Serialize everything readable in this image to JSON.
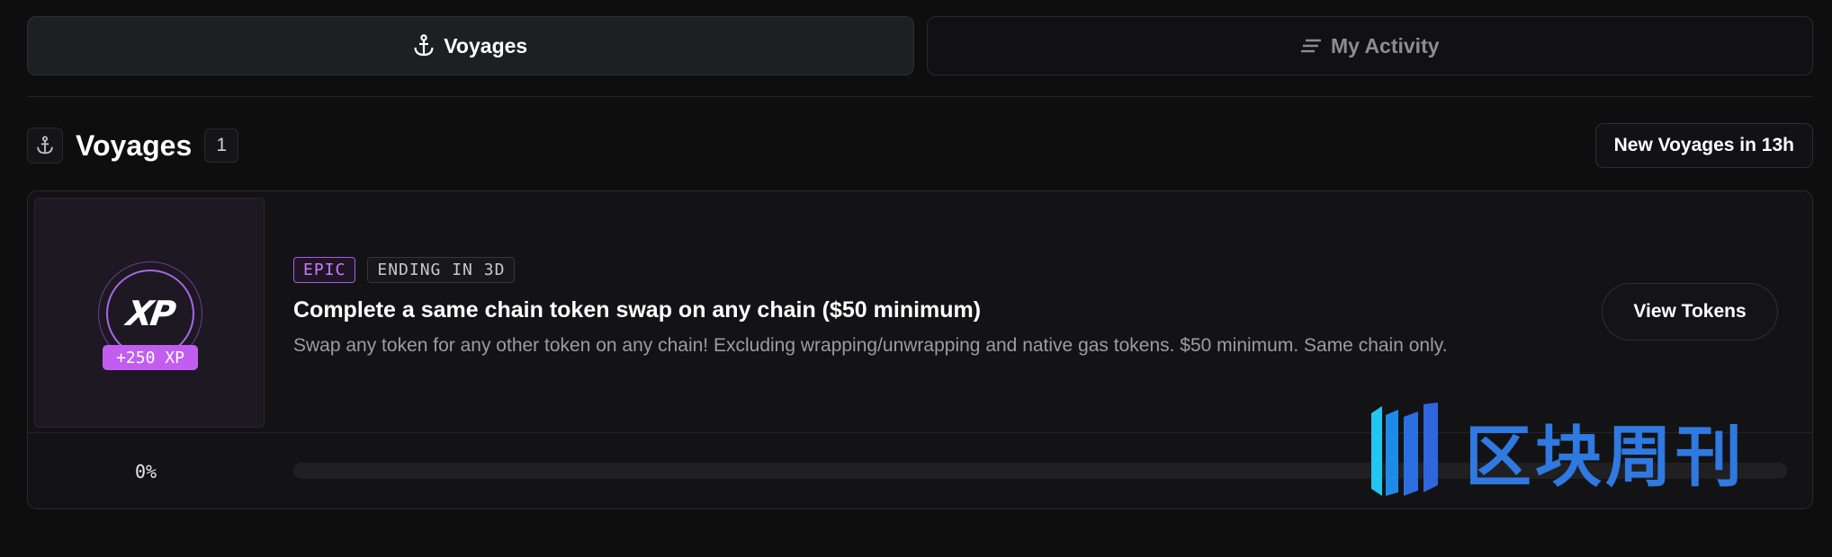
{
  "tabs": [
    {
      "label": "Voyages",
      "icon": "anchor-icon",
      "active": true
    },
    {
      "label": "My Activity",
      "icon": "list-lines-icon",
      "active": false
    }
  ],
  "section": {
    "title": "Voyages",
    "count": "1",
    "icon": "anchor-icon",
    "new_voyages_label": "New Voyages in 13h"
  },
  "voyage": {
    "thumbnail": {
      "logo_text": "XP",
      "reward": "+250 XP"
    },
    "rarity": "EPIC",
    "ending": "ENDING IN 3D",
    "title": "Complete a same chain token swap on any chain ($50 minimum)",
    "description": "Swap any token for any other token on any chain! Excluding wrapping/unwrapping and native gas tokens. $50 minimum. Same chain only.",
    "action_label": "View Tokens",
    "progress_label": "0%",
    "progress": 0
  },
  "watermark": {
    "text": "区块周刊"
  },
  "colors": {
    "background": "#0e0e0f",
    "epic": "#c15ef0",
    "watermark": "#2f79e0"
  }
}
